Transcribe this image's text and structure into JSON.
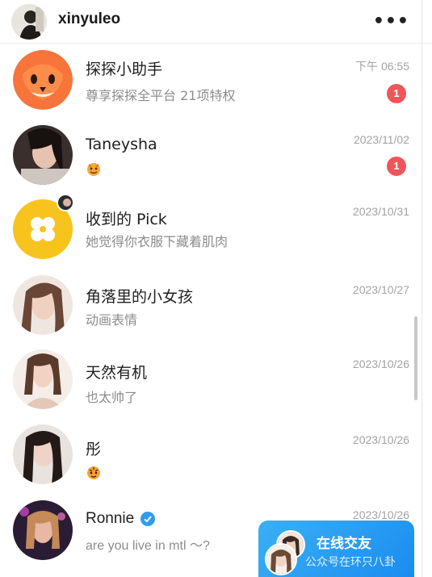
{
  "header": {
    "username": "xinyuleo",
    "more_label": "•••"
  },
  "chats": [
    {
      "name": "探探小助手",
      "preview": "尊享探探全平台 21项特权",
      "time": "下午 06:55",
      "badge": "1"
    },
    {
      "name": "Taneysha",
      "preview": "",
      "time": "2023/11/02",
      "badge": "1"
    },
    {
      "name": "收到的 Pick",
      "preview": "她觉得你衣服下藏着肌肉",
      "time": "2023/10/31"
    },
    {
      "name": "角落里的小女孩",
      "preview": "动画表情",
      "time": "2023/10/27"
    },
    {
      "name": "天然有机",
      "preview": "也太帅了",
      "time": "2023/10/26"
    },
    {
      "name": "彤",
      "preview": "",
      "time": "2023/10/26"
    },
    {
      "name": "Ronnie",
      "preview": "are you live in mtl ～?",
      "time": "2023/10/26"
    }
  ],
  "online_card": {
    "title": "在线交友",
    "watermark": "公众号在环只八卦"
  },
  "colors": {
    "badge": "#f0555a",
    "card": "#1a8cf0",
    "assistant": "#f7743a",
    "pick": "#f7c41d",
    "verified": "#2f9cf0"
  }
}
